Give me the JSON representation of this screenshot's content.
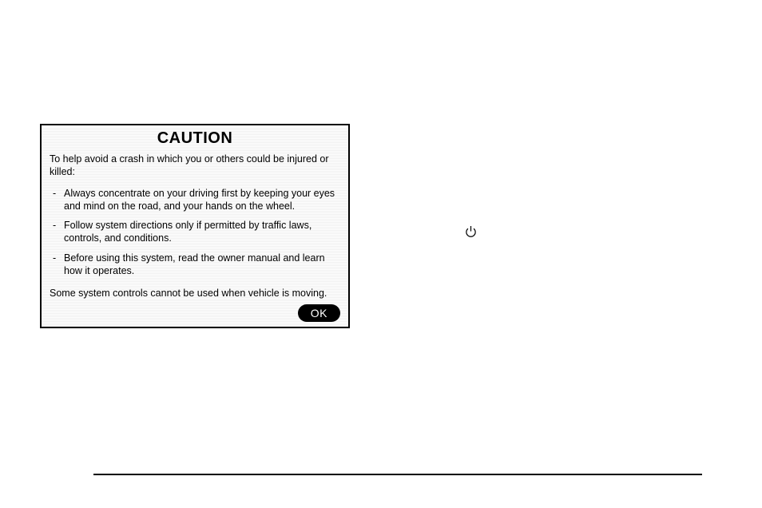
{
  "caution": {
    "title": "CAUTION",
    "intro": "To help avoid a crash in which you or others could be injured or killed:",
    "bullets": [
      "Always concentrate on your driving first by keeping your eyes and mind on the road, and your hands on the wheel.",
      "Follow system directions only if permitted by traffic laws, controls, and conditions.",
      "Before using this system, read the owner manual and learn how it operates."
    ],
    "footer": "Some system controls cannot be used when vehicle is moving.",
    "ok_label": "OK"
  },
  "icons": {
    "power": "power-icon"
  }
}
